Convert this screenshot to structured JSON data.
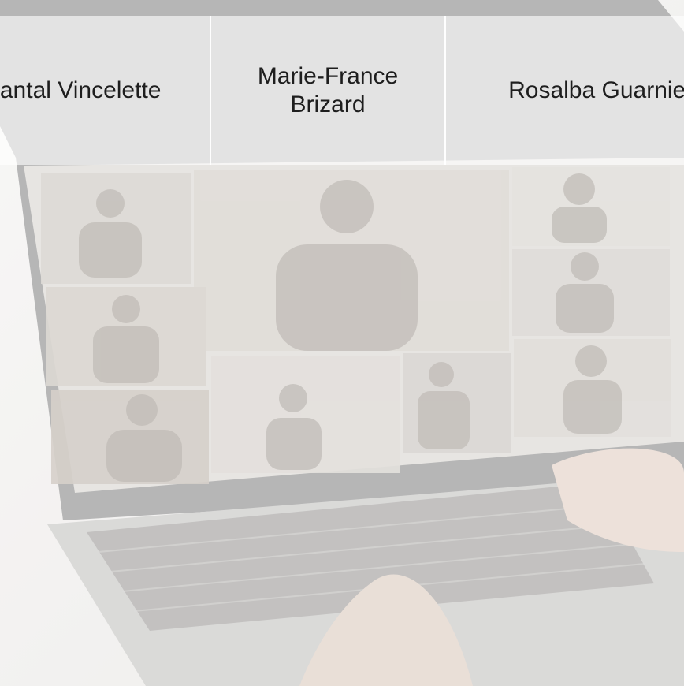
{
  "participants": [
    {
      "name": "Chantal Vincelette"
    },
    {
      "name": "Marie-France\nBrizard"
    },
    {
      "name": "Rosalba Guarnieri"
    }
  ],
  "colors": {
    "background": "#eceae8",
    "laptop_frame": "#7a7a7a",
    "screen": "#d9d6d2",
    "keyboard": "#a9a7a5",
    "text": "#1e1e1e"
  }
}
